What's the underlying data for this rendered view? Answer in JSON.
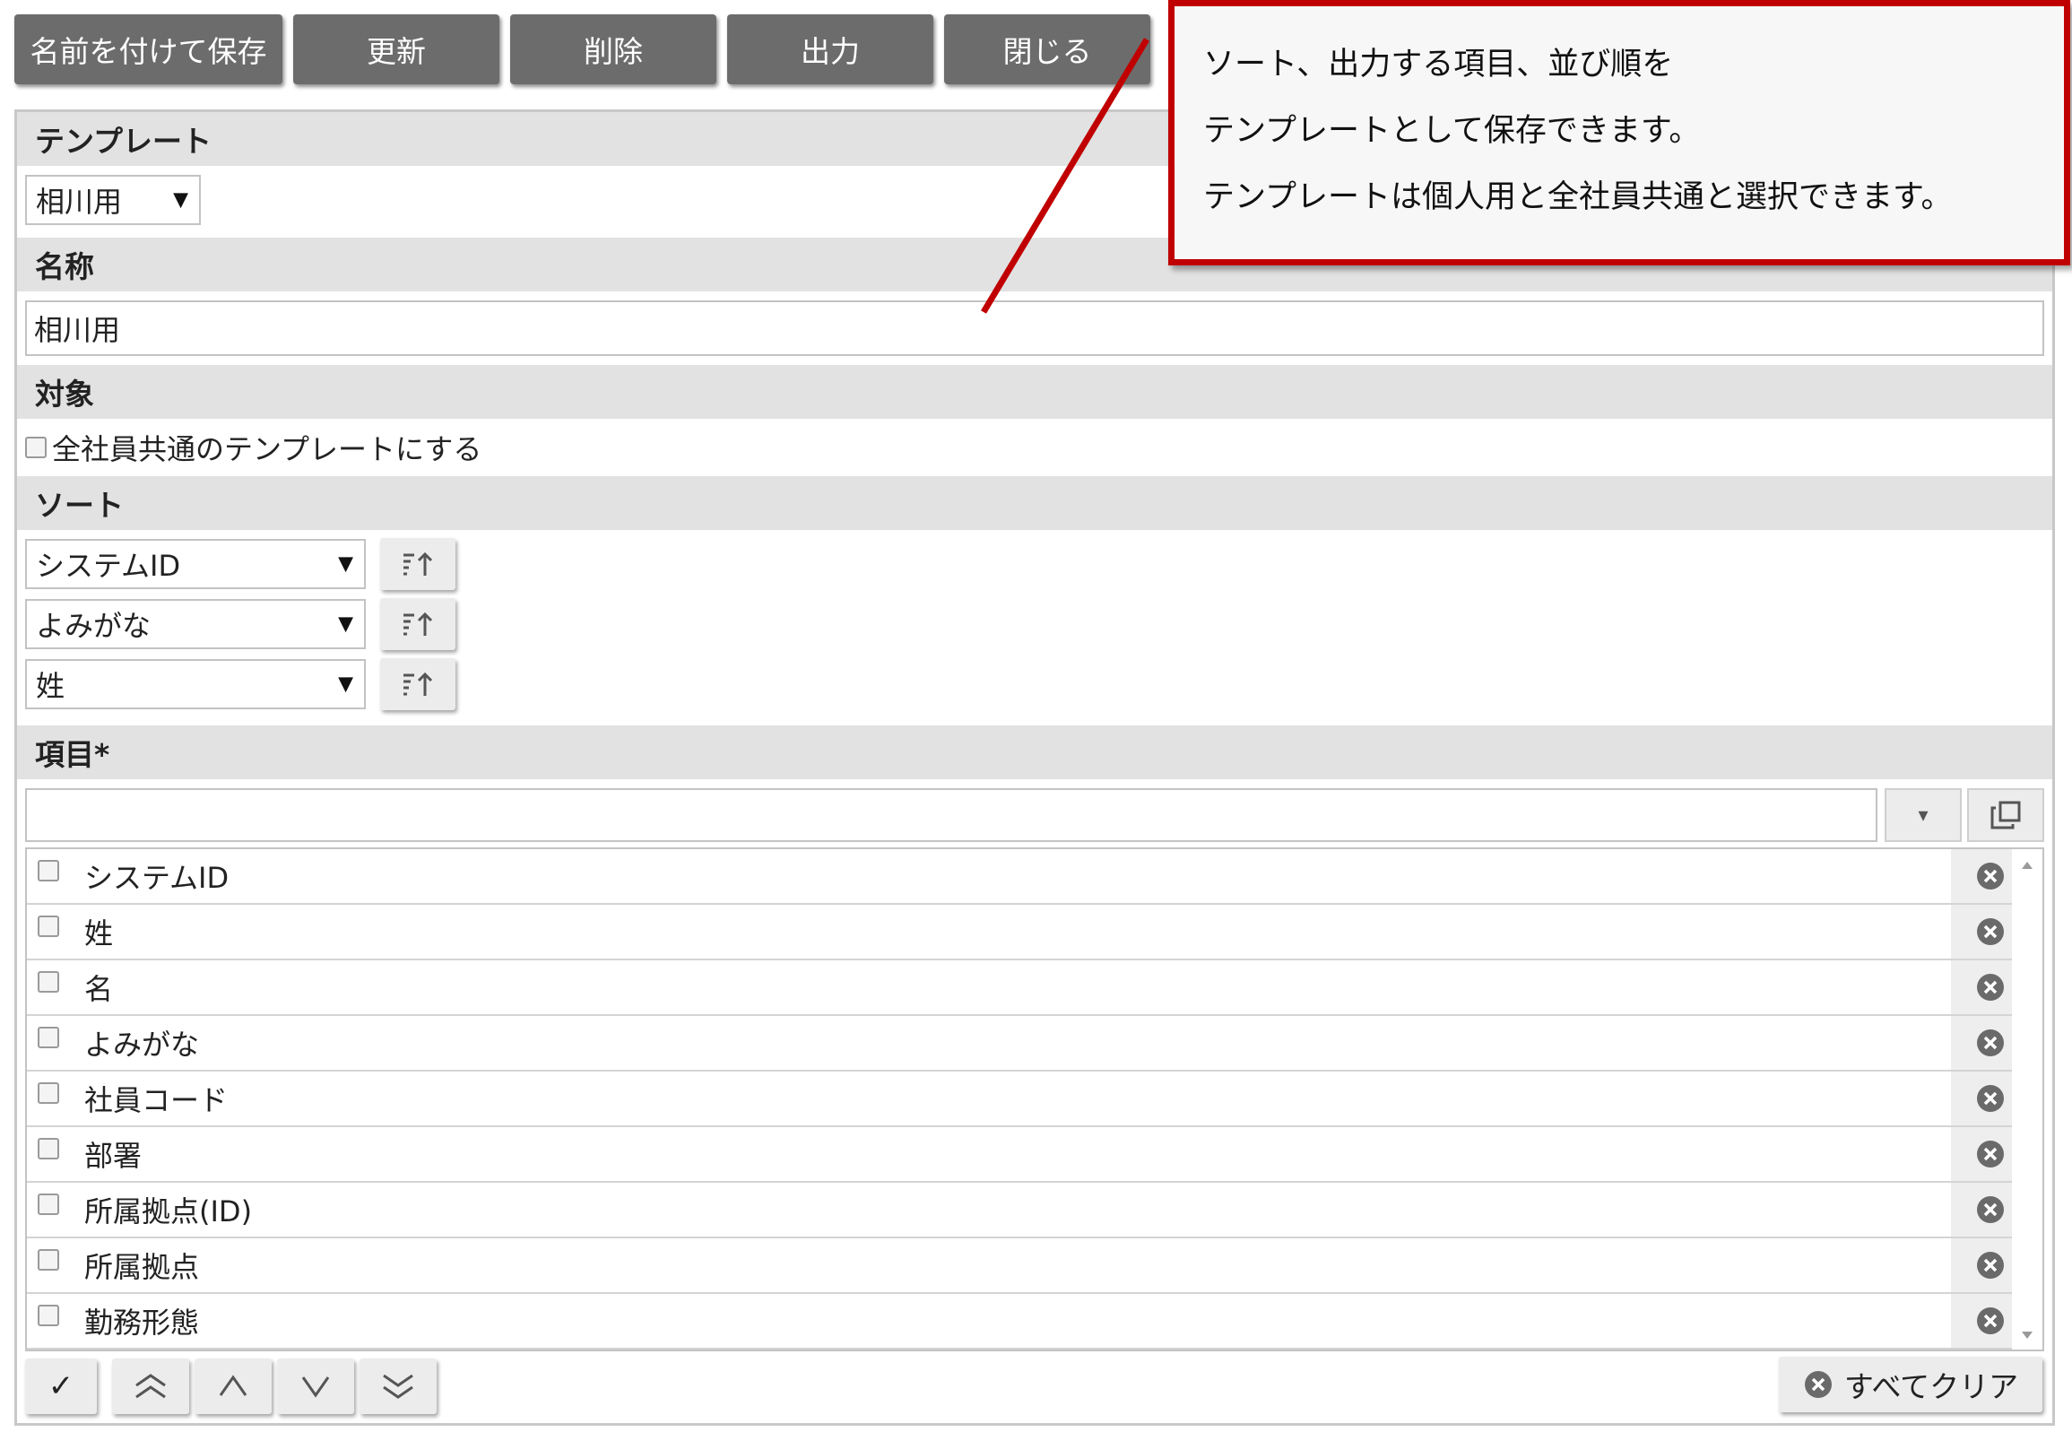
{
  "toolbar": {
    "save_as": "名前を付けて保存",
    "update": "更新",
    "delete": "削除",
    "export": "出力",
    "close": "閉じる"
  },
  "sections": {
    "template": "テンプレート",
    "name": "名称",
    "target": "対象",
    "sort": "ソート",
    "items": "項目*"
  },
  "template_select": "相川用",
  "name_value": "相川用",
  "target_checkbox_label": "全社員共通のテンプレートにする",
  "sort": [
    "システムID",
    "よみがな",
    "姓"
  ],
  "items_search_value": "",
  "items": [
    "システムID",
    "姓",
    "名",
    "よみがな",
    "社員コード",
    "部署",
    "所属拠点(ID)",
    "所属拠点",
    "勤務形態"
  ],
  "bottom": {
    "check": "✓",
    "clear_all": "すべてクリア"
  },
  "callout": {
    "line1": "ソート、出力する項目、並び順を",
    "line2": "テンプレートとして保存できます。",
    "line3": "テンプレートは個人用と全社員共通と選択できます。"
  },
  "colors": {
    "button_dark": "#6c6c6c",
    "section_header": "#e2e2e2",
    "callout_border": "#c00000"
  },
  "icons": {
    "sort_direction": "sort-ascending-icon",
    "remove": "circle-x-icon",
    "expand": "copy-window-icon"
  }
}
